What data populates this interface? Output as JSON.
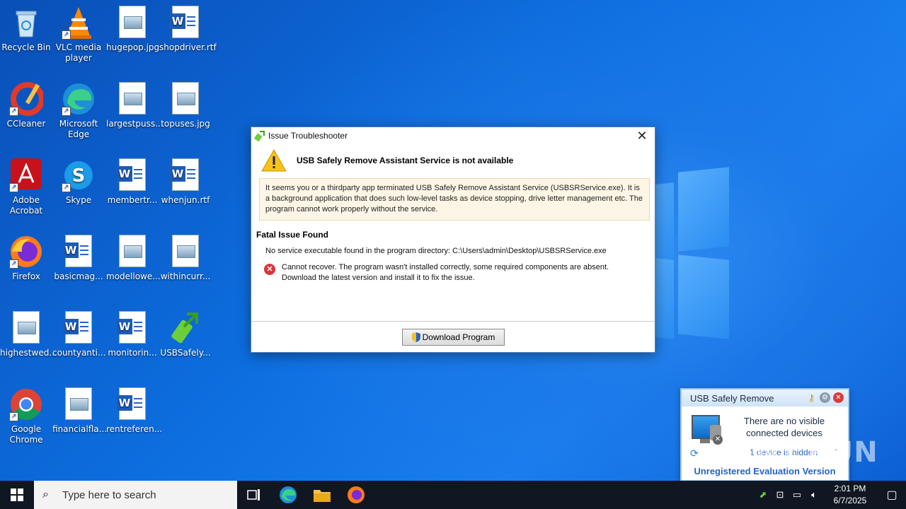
{
  "desktop": {
    "icons": [
      {
        "label": "Recycle Bin",
        "icon": "recycle-bin-icon"
      },
      {
        "label": "VLC media player",
        "icon": "vlc-icon"
      },
      {
        "label": "hugepop.jpg",
        "icon": "image-file-icon"
      },
      {
        "label": "shopdriver.rtf",
        "icon": "word-doc-icon"
      },
      {
        "label": "CCleaner",
        "icon": "ccleaner-icon"
      },
      {
        "label": "Microsoft Edge",
        "icon": "edge-icon"
      },
      {
        "label": "largestpuss...",
        "icon": "image-file-icon"
      },
      {
        "label": "topuses.jpg",
        "icon": "image-file-icon"
      },
      {
        "label": "Adobe Acrobat",
        "icon": "acrobat-icon"
      },
      {
        "label": "Skype",
        "icon": "skype-icon"
      },
      {
        "label": "membertr...",
        "icon": "word-doc-icon"
      },
      {
        "label": "whenjun.rtf",
        "icon": "word-doc-icon"
      },
      {
        "label": "Firefox",
        "icon": "firefox-icon"
      },
      {
        "label": "basicmag...",
        "icon": "word-doc-icon"
      },
      {
        "label": "modellowe...",
        "icon": "image-file-icon"
      },
      {
        "label": "withincurr...",
        "icon": "image-file-icon"
      },
      {
        "label": "highestwed...",
        "icon": "image-file-icon"
      },
      {
        "label": "countyanti...",
        "icon": "word-doc-icon"
      },
      {
        "label": "monitorin...",
        "icon": "word-doc-icon"
      },
      {
        "label": "USBSafely...",
        "icon": "usb-safely-icon"
      },
      {
        "label": "Google Chrome",
        "icon": "chrome-icon"
      },
      {
        "label": "financialfla...",
        "icon": "image-file-icon"
      },
      {
        "label": "rentreferen...",
        "icon": "word-doc-icon"
      }
    ]
  },
  "dialog": {
    "title": "Issue Troubleshooter",
    "heading": "USB Safely Remove Assistant Service is not available",
    "notice": "It seems you or a thirdparty app terminated USB Safely Remove Assistant Service (USBSRService.exe). It is a background application that does such low-level tasks as device stopping, drive letter management etc. The program cannot work properly without the service.",
    "fatal_title": "Fatal Issue Found",
    "no_service": "No service executable found in the program directory: C:\\Users\\admin\\Desktop\\USBSRService.exe",
    "error_text": "Cannot recover. The program wasn't installed correctly, some required components are absent. Download the latest version and install it to fix the issue.",
    "download_label": "Download Program"
  },
  "popup": {
    "title": "USB Safely Remove",
    "message": "There are no visible connected devices",
    "hidden_link": "1 device is hidden",
    "footer": "Unregistered Evaluation Version"
  },
  "watermark": "ANY.RUN",
  "taskbar": {
    "search_placeholder": "Type here to search",
    "time": "2:01 PM",
    "date": "6/7/2025"
  }
}
